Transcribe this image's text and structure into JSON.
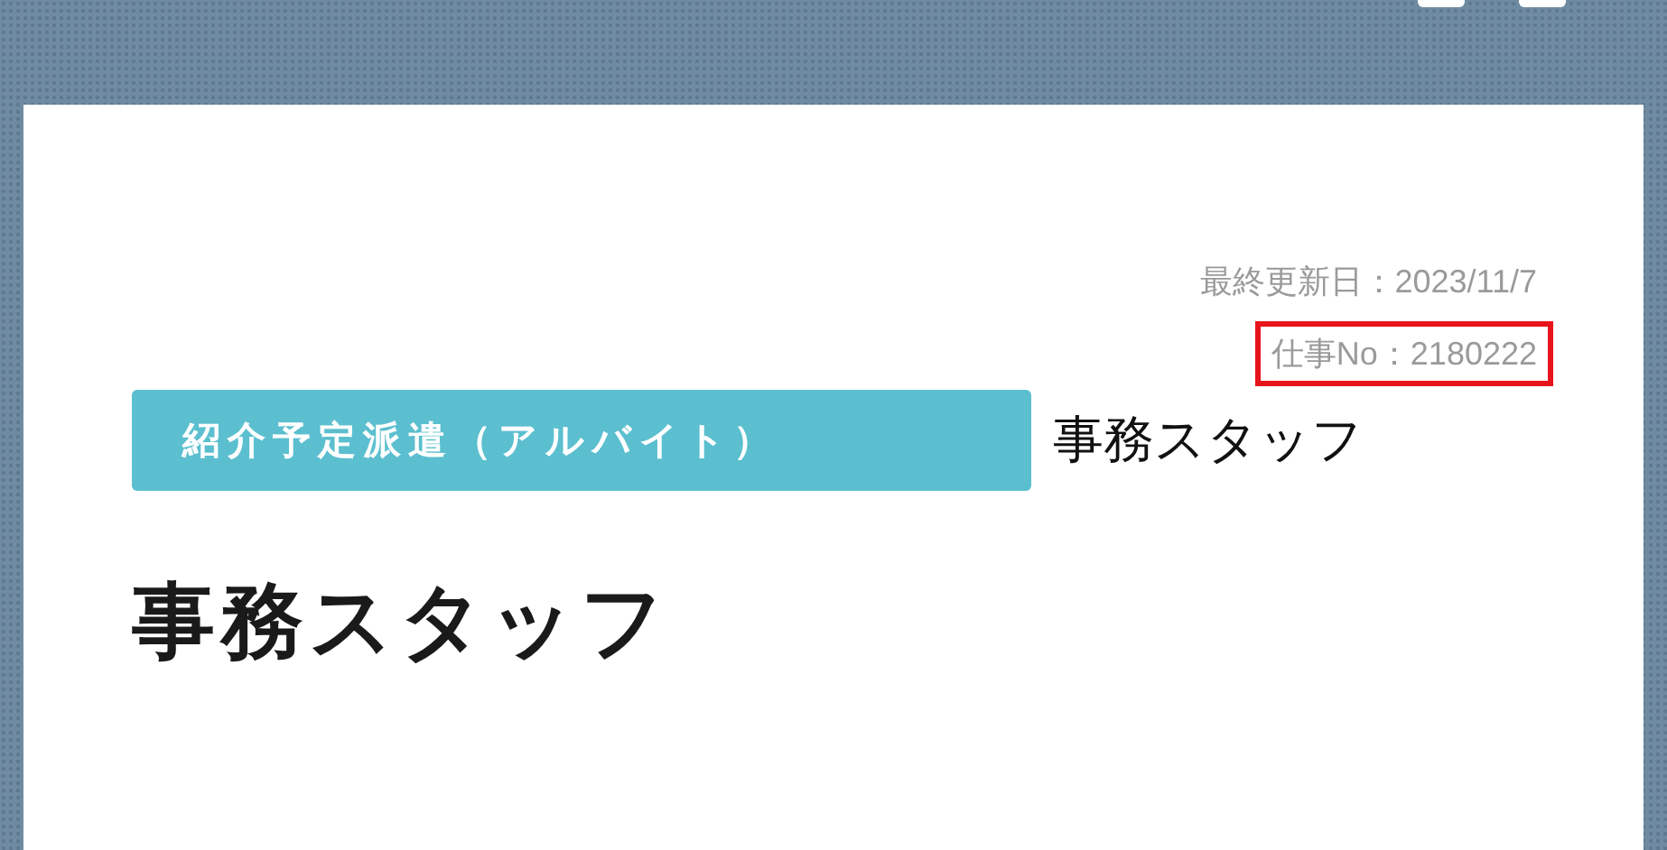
{
  "updated": {
    "label": "最終更新日：2023/11/7",
    "highlighted": false
  },
  "job_no": {
    "label": "仕事No：2180222",
    "highlighted": true
  },
  "category_tag": "紹介予定派遣（アルバイト）",
  "subtitle": "事務スタッフ",
  "title": "事務スタッフ"
}
